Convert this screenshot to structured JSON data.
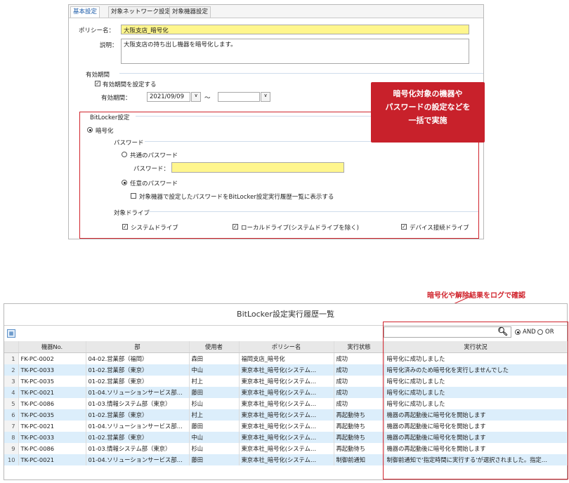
{
  "settings": {
    "tabs": [
      "基本設定",
      "対象ネットワーク設定",
      "対象機器設定"
    ],
    "policy_name_label": "ポリシー名：",
    "policy_name_value": "大阪支店_暗号化",
    "description_label": "説明：",
    "description_value": "大阪支店の持ち出し機器を暗号化します。",
    "validity_section": "有効期間",
    "validity_checkbox": "有効期間を設定する",
    "validity_period_label": "有効期間：",
    "start_date": "2021/09/09",
    "tilde": "～",
    "bitlocker_section": "BitLocker設定",
    "encrypt_radio": "暗号化",
    "password_section": "パスワード",
    "shared_password_radio": "共通のパスワード",
    "password_label": "パスワード：",
    "password_value": "",
    "any_password_radio": "任意のパスワード",
    "show_password_checkbox": "対象機器で設定したパスワードをBitLocker設定実行履歴一覧に表示する",
    "target_drive_section": "対象ドライブ",
    "system_drive": "システムドライブ",
    "local_drive": "ローカルドライブ(システムドライブを除く)",
    "device_drive": "デバイス接続ドライブ"
  },
  "callout_text": [
    "暗号化対象の機器や",
    "パスワードの設定などを",
    "一括で実施"
  ],
  "log_caption": "暗号化や解除結果をログで確認",
  "history": {
    "title": "BitLocker設定実行履歴一覧",
    "search_value": "",
    "and_label": "AND",
    "or_label": "OR",
    "columns": [
      "機器No.",
      "部",
      "使用者",
      "ポリシー名",
      "実行状態",
      "実行状況"
    ],
    "rows": [
      [
        "1",
        "FK-PC-0002",
        "04-02.営業部（福岡）",
        "森田",
        "福岡支店_暗号化",
        "成功",
        "暗号化に成功しました"
      ],
      [
        "2",
        "TK-PC-0033",
        "01-02.営業部（東京）",
        "中山",
        "東京本社_暗号化(システム…",
        "成功",
        "暗号化済みのため暗号化を実行しませんでした"
      ],
      [
        "3",
        "TK-PC-0035",
        "01-02.営業部（東京）",
        "村上",
        "東京本社_暗号化(システム…",
        "成功",
        "暗号化に成功しました"
      ],
      [
        "4",
        "TK-PC-0021",
        "01-04.ソリューションサービス部…",
        "藤田",
        "東京本社_暗号化(システム…",
        "成功",
        "暗号化に成功しました"
      ],
      [
        "5",
        "TK-PC-0086",
        "01-03.情報システム部（東京）",
        "杉山",
        "東京本社_暗号化(システム…",
        "成功",
        "暗号化に成功しました"
      ],
      [
        "6",
        "TK-PC-0035",
        "01-02.営業部（東京）",
        "村上",
        "東京本社_暗号化(システム…",
        "再起動待ち",
        "機器の再起動後に暗号化を開始します"
      ],
      [
        "7",
        "TK-PC-0021",
        "01-04.ソリューションサービス部…",
        "藤田",
        "東京本社_暗号化(システム…",
        "再起動待ち",
        "機器の再起動後に暗号化を開始します"
      ],
      [
        "8",
        "TK-PC-0033",
        "01-02.営業部（東京）",
        "中山",
        "東京本社_暗号化(システム…",
        "再起動待ち",
        "機器の再起動後に暗号化を開始します"
      ],
      [
        "9",
        "TK-PC-0086",
        "01-03.情報システム部（東京）",
        "杉山",
        "東京本社_暗号化(システム…",
        "再起動待ち",
        "機器の再起動後に暗号化を開始します"
      ],
      [
        "10",
        "TK-PC-0021",
        "01-04.ソリューションサービス部…",
        "藤田",
        "東京本社_暗号化(システム…",
        "制御前通知",
        "制御前通知で'指定時間に実行する'が選択されました。指定…"
      ]
    ]
  },
  "colors": {
    "accent_red": "#c8212b",
    "highlight_yellow": "#fff68d",
    "row_alt": "#dceefb"
  }
}
